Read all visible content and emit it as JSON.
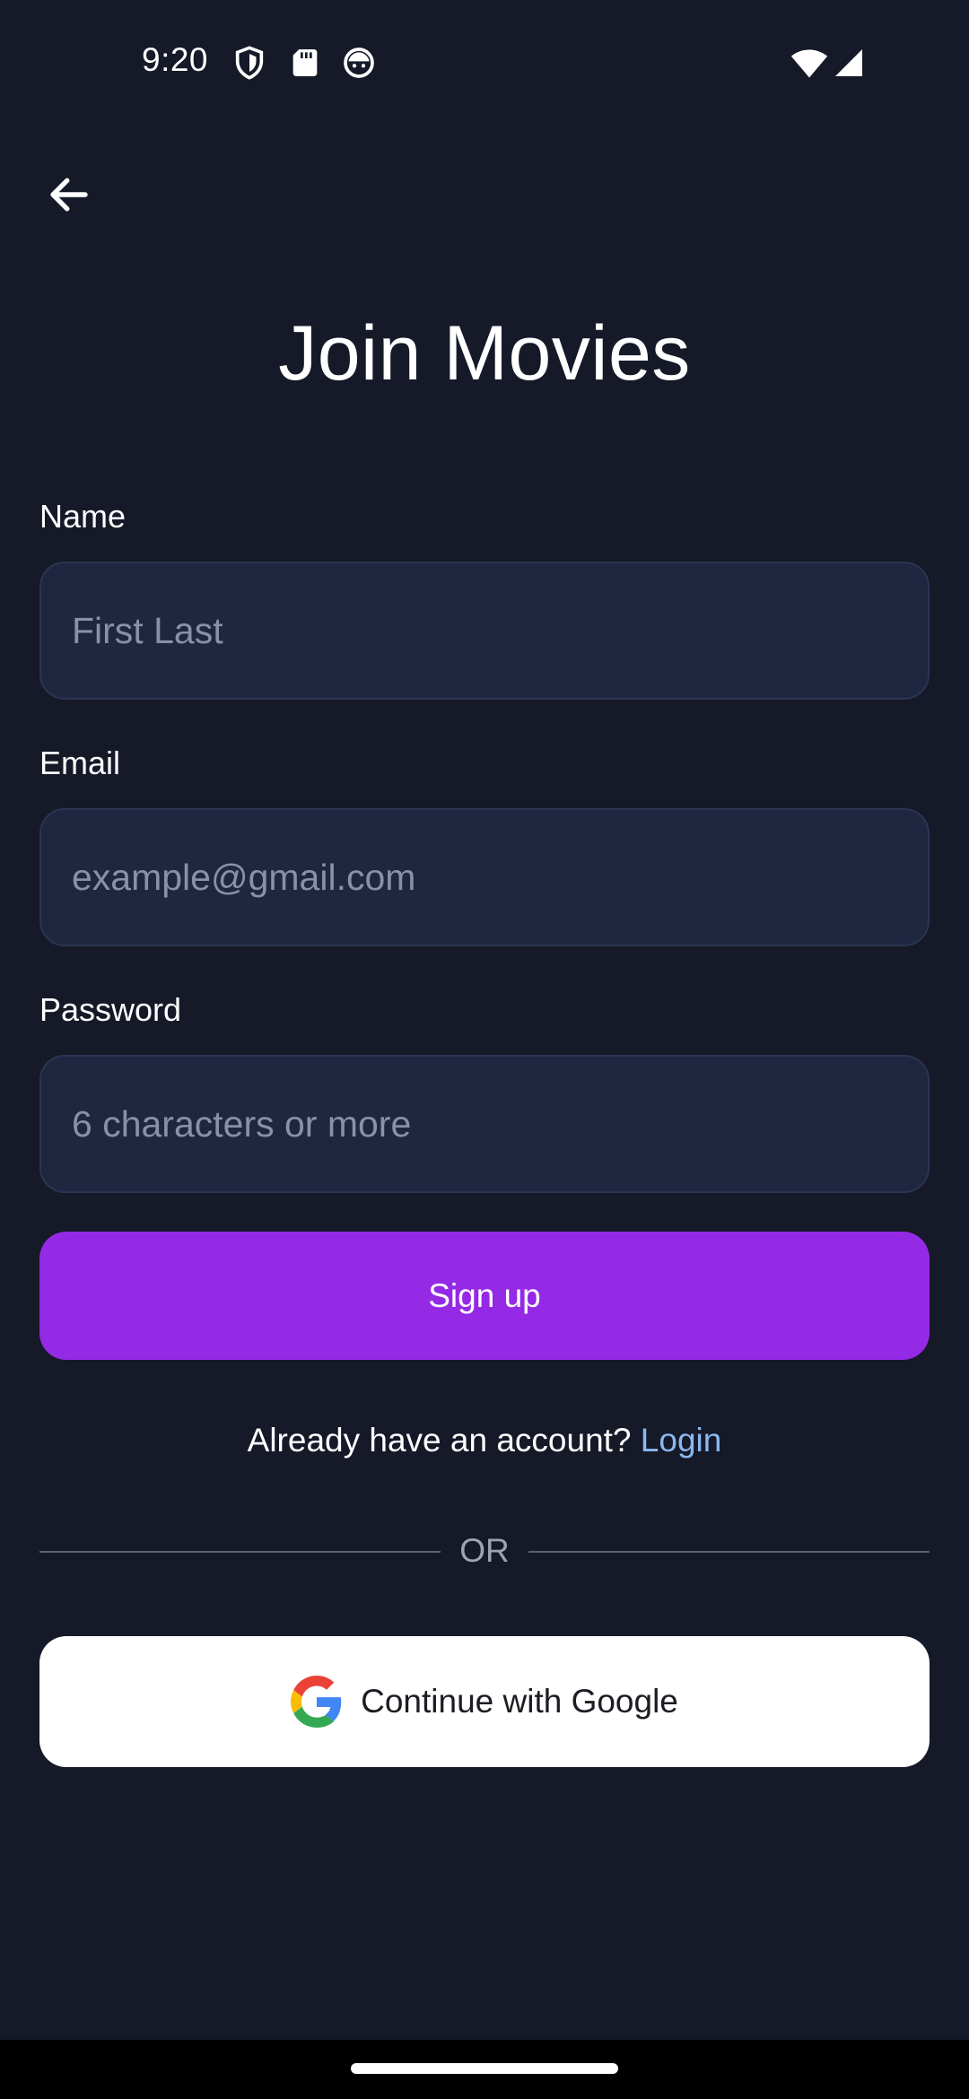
{
  "status_bar": {
    "time": "9:20",
    "icons": [
      "shield-icon",
      "sd-card-icon",
      "face-icon",
      "wifi-icon",
      "signal-icon"
    ]
  },
  "header": {
    "back_icon": "arrow-left-icon",
    "title": "Join Movies"
  },
  "form": {
    "name": {
      "label": "Name",
      "placeholder": "First Last",
      "value": ""
    },
    "email": {
      "label": "Email",
      "placeholder": "example@gmail.com",
      "value": ""
    },
    "password": {
      "label": "Password",
      "placeholder": "6 characters or more",
      "value": ""
    },
    "signup_label": "Sign up"
  },
  "login_prompt": {
    "text": "Already have an account? ",
    "link": "Login"
  },
  "divider": {
    "text": "OR"
  },
  "google": {
    "icon": "google-g-icon",
    "label": "Continue with Google"
  },
  "colors": {
    "background": "#151928",
    "input_background": "#1f2640",
    "accent": "#952ae6",
    "link": "#8ab8f0"
  }
}
